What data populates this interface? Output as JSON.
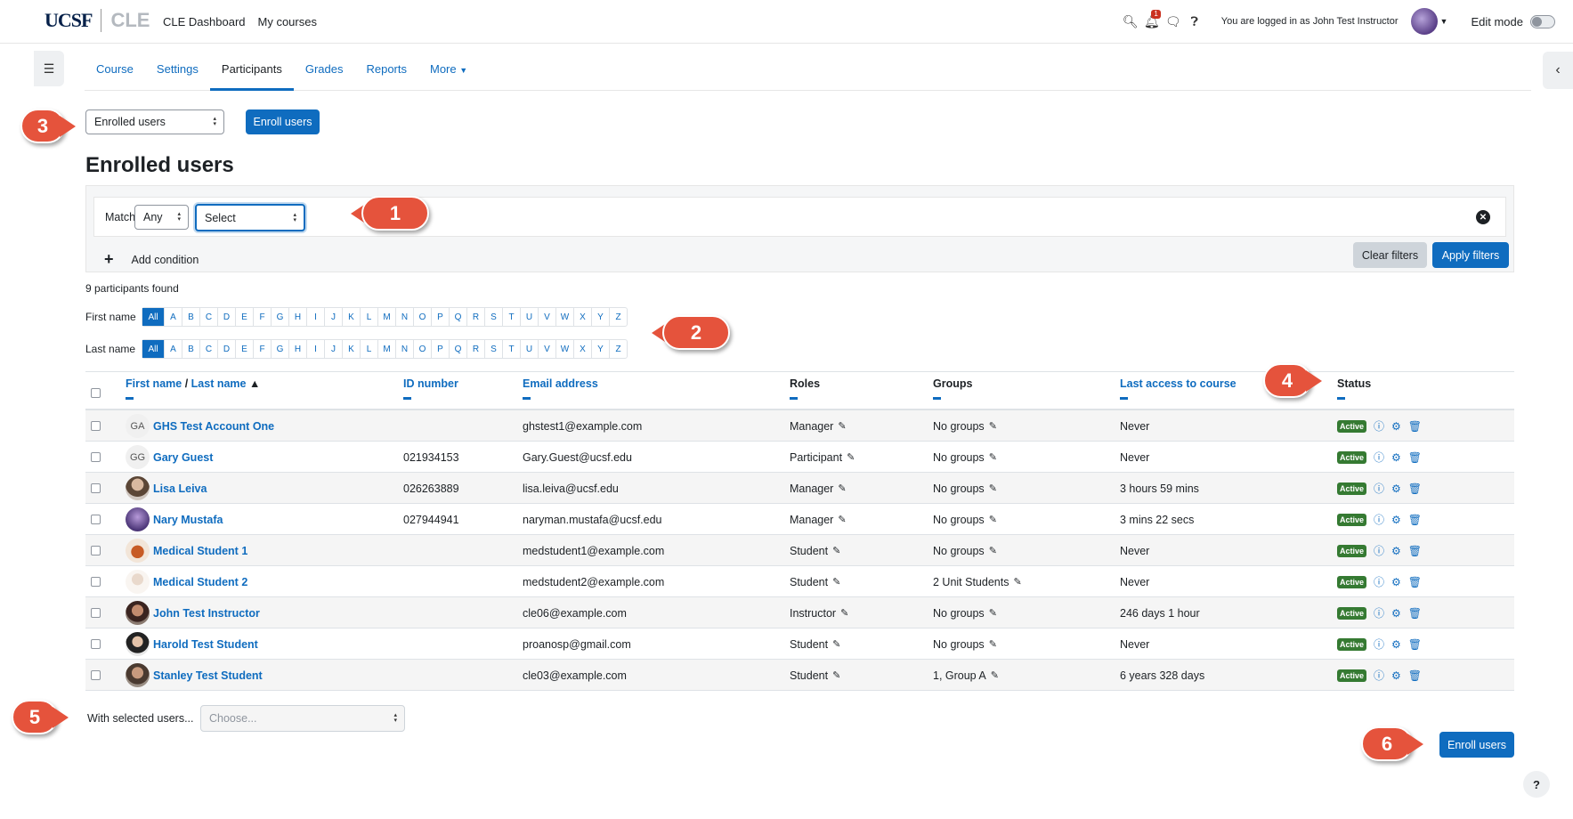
{
  "header": {
    "logo_ucsf": "UCSF",
    "logo_cle": "CLE",
    "nav": [
      "CLE Dashboard",
      "My courses"
    ],
    "notification_count": "1",
    "logged_in_text": "You are logged in as John Test Instructor",
    "edit_mode_label": "Edit mode"
  },
  "tabs": [
    "Course",
    "Settings",
    "Participants",
    "Grades",
    "Reports",
    "More"
  ],
  "active_tab": "Participants",
  "toolbar": {
    "view_select": "Enrolled users",
    "enroll_button": "Enroll users"
  },
  "page_title": "Enrolled users",
  "filter": {
    "match_label": "Match",
    "match_value": "Any",
    "condition_select": "Select",
    "add_condition": "Add condition",
    "clear_filters": "Clear filters",
    "apply_filters": "Apply filters"
  },
  "participants_found": "9 participants found",
  "initials": {
    "first_label": "First name",
    "last_label": "Last name",
    "letters": [
      "All",
      "A",
      "B",
      "C",
      "D",
      "E",
      "F",
      "G",
      "H",
      "I",
      "J",
      "K",
      "L",
      "M",
      "N",
      "O",
      "P",
      "Q",
      "R",
      "S",
      "T",
      "U",
      "V",
      "W",
      "X",
      "Y",
      "Z"
    ]
  },
  "table": {
    "headers": {
      "first_name": "First name",
      "slash": "/",
      "last_name": "Last name",
      "id_number": "ID number",
      "email": "Email address",
      "roles": "Roles",
      "groups": "Groups",
      "last_access": "Last access to course",
      "status": "Status"
    },
    "rows": [
      {
        "initials": "GA",
        "name": "GHS Test Account One",
        "id": "",
        "email": "ghstest1@example.com",
        "role": "Manager",
        "groups": "No groups",
        "access": "Never",
        "status": "Active"
      },
      {
        "initials": "GG",
        "name": "Gary Guest",
        "id": "021934153",
        "email": "Gary.Guest@ucsf.edu",
        "role": "Participant",
        "groups": "No groups",
        "access": "Never",
        "status": "Active"
      },
      {
        "initials": "",
        "name": "Lisa Leiva",
        "id": "026263889",
        "email": "lisa.leiva@ucsf.edu",
        "role": "Manager",
        "groups": "No groups",
        "access": "3 hours 59 mins",
        "status": "Active"
      },
      {
        "initials": "",
        "name": "Nary Mustafa",
        "id": "027944941",
        "email": "naryman.mustafa@ucsf.edu",
        "role": "Manager",
        "groups": "No groups",
        "access": "3 mins 22 secs",
        "status": "Active"
      },
      {
        "initials": "",
        "name": "Medical Student 1",
        "id": "",
        "email": "medstudent1@example.com",
        "role": "Student",
        "groups": "No groups",
        "access": "Never",
        "status": "Active"
      },
      {
        "initials": "",
        "name": "Medical Student 2",
        "id": "",
        "email": "medstudent2@example.com",
        "role": "Student",
        "groups": "2 Unit Students",
        "access": "Never",
        "status": "Active"
      },
      {
        "initials": "",
        "name": "John Test Instructor",
        "id": "",
        "email": "cle06@example.com",
        "role": "Instructor",
        "groups": "No groups",
        "access": "246 days 1 hour",
        "status": "Active"
      },
      {
        "initials": "",
        "name": "Harold Test Student",
        "id": "",
        "email": "proanosp@gmail.com",
        "role": "Student",
        "groups": "No groups",
        "access": "Never",
        "status": "Active"
      },
      {
        "initials": "",
        "name": "Stanley Test Student",
        "id": "",
        "email": "cle03@example.com",
        "role": "Student",
        "groups": "1, Group A",
        "access": "6 years 328 days",
        "status": "Active"
      }
    ]
  },
  "bulk": {
    "label": "With selected users...",
    "placeholder": "Choose..."
  },
  "bottom_enroll": "Enroll users",
  "help": "?",
  "callouts": [
    "1",
    "2",
    "3",
    "4",
    "5",
    "6"
  ],
  "colors": {
    "primary": "#0f6cbf",
    "callout": "#e5533c",
    "active": "#357a32"
  }
}
